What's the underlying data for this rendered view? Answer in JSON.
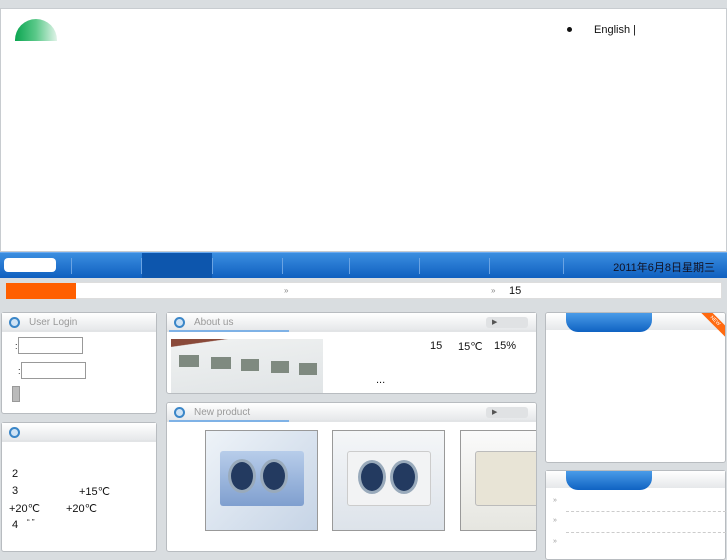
{
  "header": {
    "language": "English |"
  },
  "nav": {
    "date": "2011年6月8日星期三"
  },
  "notice": {
    "item1": "»",
    "item2": "»",
    "item2_text": "15"
  },
  "login": {
    "title": "User Login",
    "field1_label": ":",
    "field2_label": ":"
  },
  "about": {
    "title": "About us",
    "more": "▶",
    "stat1": "15",
    "stat2": "15℃",
    "stat3": "15%",
    "ellipsis": "..."
  },
  "info": {
    "lines": [
      "2",
      "3",
      "+15℃",
      "+20℃",
      "+20℃",
      "4",
      "“ ”"
    ]
  },
  "product": {
    "title": "New product",
    "more": "▶"
  },
  "right": {
    "badge": "NEW",
    "list_marker": "»"
  }
}
